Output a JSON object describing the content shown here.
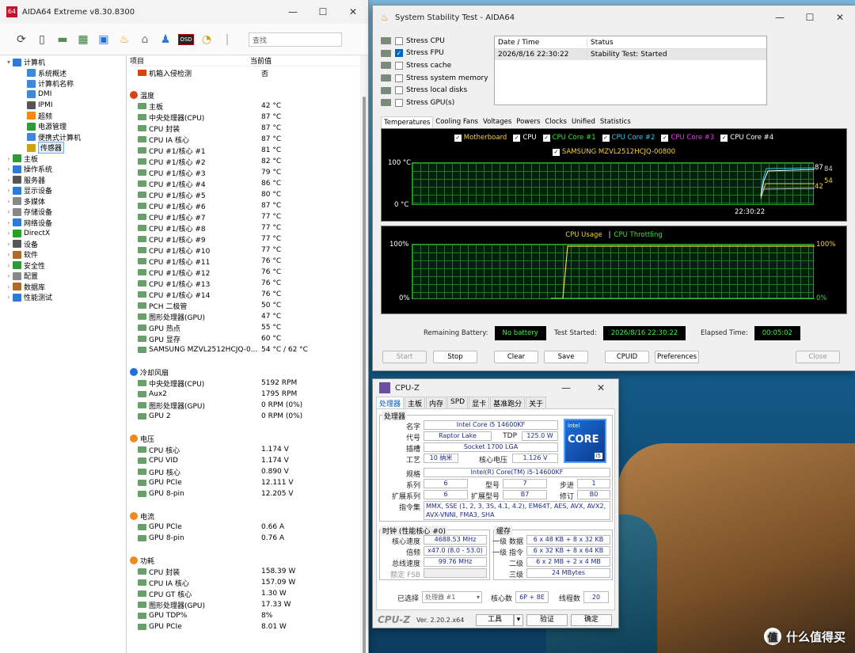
{
  "aida": {
    "title": "AIDA64 Extreme v8.30.8300",
    "logo": "64",
    "search_placeholder": "查找",
    "col_item": "项目",
    "col_value": "当前值",
    "tree": [
      {
        "label": "计算机",
        "level": 0,
        "exp": "▾",
        "color": "#2d7bd6"
      },
      {
        "label": "系统概述",
        "level": 1,
        "exp": "",
        "color": "#3e8ad9"
      },
      {
        "label": "计算机名称",
        "level": 1,
        "exp": "",
        "color": "#3e8ad9"
      },
      {
        "label": "DMI",
        "level": 1,
        "exp": "",
        "color": "#3e8ad9"
      },
      {
        "label": "IPMI",
        "level": 1,
        "exp": "",
        "color": "#555"
      },
      {
        "label": "超频",
        "level": 1,
        "exp": "",
        "color": "#f08a1c"
      },
      {
        "label": "电源管理",
        "level": 1,
        "exp": "",
        "color": "#2f9a3a"
      },
      {
        "label": "便携式计算机",
        "level": 1,
        "exp": "",
        "color": "#3e8ad9"
      },
      {
        "label": "传感器",
        "level": 1,
        "exp": "",
        "color": "#cfa20f",
        "selected": true
      },
      {
        "label": "主板",
        "level": 0,
        "exp": "›",
        "color": "#2f9a3a"
      },
      {
        "label": "操作系统",
        "level": 0,
        "exp": "›",
        "color": "#2d7bd6"
      },
      {
        "label": "服务器",
        "level": 0,
        "exp": "›",
        "color": "#555"
      },
      {
        "label": "显示设备",
        "level": 0,
        "exp": "›",
        "color": "#2d7bd6"
      },
      {
        "label": "多媒体",
        "level": 0,
        "exp": "›",
        "color": "#888"
      },
      {
        "label": "存储设备",
        "level": 0,
        "exp": "›",
        "color": "#888"
      },
      {
        "label": "网络设备",
        "level": 0,
        "exp": "›",
        "color": "#2d7bd6"
      },
      {
        "label": "DirectX",
        "level": 0,
        "exp": "›",
        "color": "#25a325"
      },
      {
        "label": "设备",
        "level": 0,
        "exp": "›",
        "color": "#555"
      },
      {
        "label": "软件",
        "level": 0,
        "exp": "›",
        "color": "#b06a2a"
      },
      {
        "label": "安全性",
        "level": 0,
        "exp": "›",
        "color": "#2f9a3a"
      },
      {
        "label": "配置",
        "level": 0,
        "exp": "›",
        "color": "#888"
      },
      {
        "label": "数据库",
        "level": 0,
        "exp": "›",
        "color": "#b06a2a"
      },
      {
        "label": "性能测试",
        "level": 0,
        "exp": "›",
        "color": "#2d7bd6"
      }
    ],
    "first_row": {
      "name": "机箱入侵检测",
      "value": "否"
    },
    "groups": [
      {
        "title": "温度",
        "rows": [
          [
            "主板",
            "42 °C"
          ],
          [
            "中央处理器(CPU)",
            "87 °C"
          ],
          [
            "CPU 封装",
            "87 °C"
          ],
          [
            "CPU IA 核心",
            "87 °C"
          ],
          [
            "CPU #1/核心 #1",
            "81 °C"
          ],
          [
            "CPU #1/核心 #2",
            "82 °C"
          ],
          [
            "CPU #1/核心 #3",
            "79 °C"
          ],
          [
            "CPU #1/核心 #4",
            "86 °C"
          ],
          [
            "CPU #1/核心 #5",
            "80 °C"
          ],
          [
            "CPU #1/核心 #6",
            "87 °C"
          ],
          [
            "CPU #1/核心 #7",
            "77 °C"
          ],
          [
            "CPU #1/核心 #8",
            "77 °C"
          ],
          [
            "CPU #1/核心 #9",
            "77 °C"
          ],
          [
            "CPU #1/核心 #10",
            "77 °C"
          ],
          [
            "CPU #1/核心 #11",
            "76 °C"
          ],
          [
            "CPU #1/核心 #12",
            "76 °C"
          ],
          [
            "CPU #1/核心 #13",
            "76 °C"
          ],
          [
            "CPU #1/核心 #14",
            "76 °C"
          ],
          [
            "PCH 二极管",
            "50 °C"
          ],
          [
            "图形处理器(GPU)",
            "47 °C"
          ],
          [
            "GPU 热点",
            "55 °C"
          ],
          [
            "GPU 显存",
            "60 °C"
          ],
          [
            "SAMSUNG MZVL2512HCJQ-0...",
            "54 °C / 62 °C"
          ]
        ]
      },
      {
        "title": "冷却风扇",
        "rows": [
          [
            "中央处理器(CPU)",
            "5192 RPM"
          ],
          [
            "Aux2",
            "1795 RPM"
          ],
          [
            "图形处理器(GPU)",
            "0 RPM  (0%)"
          ],
          [
            "GPU 2",
            "0 RPM  (0%)"
          ]
        ]
      },
      {
        "title": "电压",
        "rows": [
          [
            "CPU 核心",
            "1.174 V"
          ],
          [
            "CPU VID",
            "1.174 V"
          ],
          [
            "GPU 核心",
            "0.890 V"
          ],
          [
            "GPU PCIe",
            "12.111 V"
          ],
          [
            "GPU 8-pin",
            "12.205 V"
          ]
        ]
      },
      {
        "title": "电流",
        "rows": [
          [
            "GPU PCIe",
            "0.66 A"
          ],
          [
            "GPU 8-pin",
            "0.76 A"
          ]
        ]
      },
      {
        "title": "功耗",
        "rows": [
          [
            "CPU 封装",
            "158.39 W"
          ],
          [
            "CPU IA 核心",
            "157.09 W"
          ],
          [
            "CPU GT 核心",
            "1.30 W"
          ],
          [
            "图形处理器(GPU)",
            "17.33 W"
          ],
          [
            "GPU TDP%",
            "8%"
          ],
          [
            "GPU PCIe",
            "8.01 W"
          ]
        ]
      }
    ]
  },
  "sst": {
    "title": "System Stability Test - AIDA64",
    "options": [
      {
        "label": "Stress CPU",
        "checked": false
      },
      {
        "label": "Stress FPU",
        "checked": true
      },
      {
        "label": "Stress cache",
        "checked": false
      },
      {
        "label": "Stress system memory",
        "checked": false
      },
      {
        "label": "Stress local disks",
        "checked": false
      },
      {
        "label": "Stress GPU(s)",
        "checked": false
      }
    ],
    "log_col1": "Date / Time",
    "log_col2": "Status",
    "log_date": "2026/8/16 22:30:22",
    "log_status": "Stability Test: Started",
    "tabs": [
      "Temperatures",
      "Cooling Fans",
      "Voltages",
      "Powers",
      "Clocks",
      "Unified",
      "Statistics"
    ],
    "legend1": [
      {
        "label": "Motherboard",
        "color": "#f3d23a"
      },
      {
        "label": "CPU",
        "color": "#ffffff"
      },
      {
        "label": "CPU Core #1",
        "color": "#38e038"
      },
      {
        "label": "CPU Core #2",
        "color": "#36c7e8"
      },
      {
        "label": "CPU Core #3",
        "color": "#e040e0"
      },
      {
        "label": "CPU Core #4",
        "color": "#ffffff"
      }
    ],
    "legend1b": {
      "label": "SAMSUNG MZVL2512HCJQ-00800",
      "color": "#f3d23a"
    },
    "g1_top": "100 °C",
    "g1_bot": "0 °C",
    "g1_time": "22:30:22",
    "g1_vals": [
      "87",
      "84",
      "54",
      "42"
    ],
    "legend2a": "CPU Usage",
    "legend2sep": "|",
    "legend2b": "CPU Throttling",
    "legend2_colors": {
      "usage": "#f3d23a",
      "throttle": "#38e038"
    },
    "g2_ltop": "100%",
    "g2_lbot": "0%",
    "g2_rtop": "100%",
    "g2_rbot": "0%",
    "rem_label": "Remaining Battery:",
    "rem_val": "No battery",
    "start_label": "Test Started:",
    "start_val": "2026/8/16 22:30:22",
    "el_label": "Elapsed Time:",
    "el_val": "00:05:02",
    "buttons": [
      "Start",
      "Stop",
      "Clear",
      "Save",
      "CPUID",
      "Preferences",
      "Close"
    ]
  },
  "cpuz": {
    "title": "CPU-Z",
    "tabs": [
      "处理器",
      "主板",
      "内存",
      "SPD",
      "显卡",
      "基准跑分",
      "关于"
    ],
    "sec_proc": "处理器",
    "name_l": "名字",
    "name_v": "Intel Core i5 14600KF",
    "code_l": "代号",
    "code_v": "Raptor Lake",
    "tdp_l": "TDP",
    "tdp_v": "125.0 W",
    "sock_l": "插槽",
    "sock_v": "Socket 1700 LGA",
    "tech_l": "工艺",
    "tech_v": "10 纳米",
    "volt_l": "核心电压",
    "volt_v": "1.126 V",
    "spec_l": "规格",
    "spec_v": "Intel(R) Core(TM) i5-14600KF",
    "fam_l": "系列",
    "fam_v": "6",
    "mod_l": "型号",
    "mod_v": "7",
    "step_l": "步进",
    "step_v": "1",
    "efam_l": "扩展系列",
    "efam_v": "6",
    "emod_l": "扩展型号",
    "emod_v": "B7",
    "rev_l": "修订",
    "rev_v": "B0",
    "inst_l": "指令集",
    "inst_v": "MMX, SSE (1, 2, 3, 3S, 4.1, 4.2), EM64T, AES, AVX, AVX2, AVX-VNNI, FMA3, SHA",
    "intel_brand": "intel",
    "intel_core": "CORE",
    "intel_tier": "i5",
    "clk_sec": "时钟 (性能核心 #0)",
    "cspd_l": "核心速度",
    "cspd_v": "4688.53 MHz",
    "mult_l": "倍频",
    "mult_v": "x47.0 (8.0 - 53.0)",
    "bus_l": "总线速度",
    "bus_v": "99.76 MHz",
    "fsb_l": "额定 FSB",
    "cache_sec": "缓存",
    "l1d_l": "一级 数据",
    "l1d_v": "6 x 48 KB + 8 x 32 KB",
    "l1i_l": "一级 指令",
    "l1i_v": "6 x 32 KB + 8 x 64 KB",
    "l2_l": "二级",
    "l2_v": "6 x 2 MB + 2 x 4 MB",
    "l3_l": "三级",
    "l3_v": "24 MBytes",
    "sel_l": "已选择",
    "sel_v": "处理器 #1",
    "cores_l": "核心数",
    "cores_v": "6P + 8E",
    "thr_l": "线程数",
    "thr_v": "20",
    "logo": "CPU-Z",
    "ver": "Ver. 2.20.2.x64",
    "tools": "工具",
    "validate": "验证",
    "ok": "确定"
  },
  "watermark": "什么值得买",
  "watermark_glyph": "值"
}
